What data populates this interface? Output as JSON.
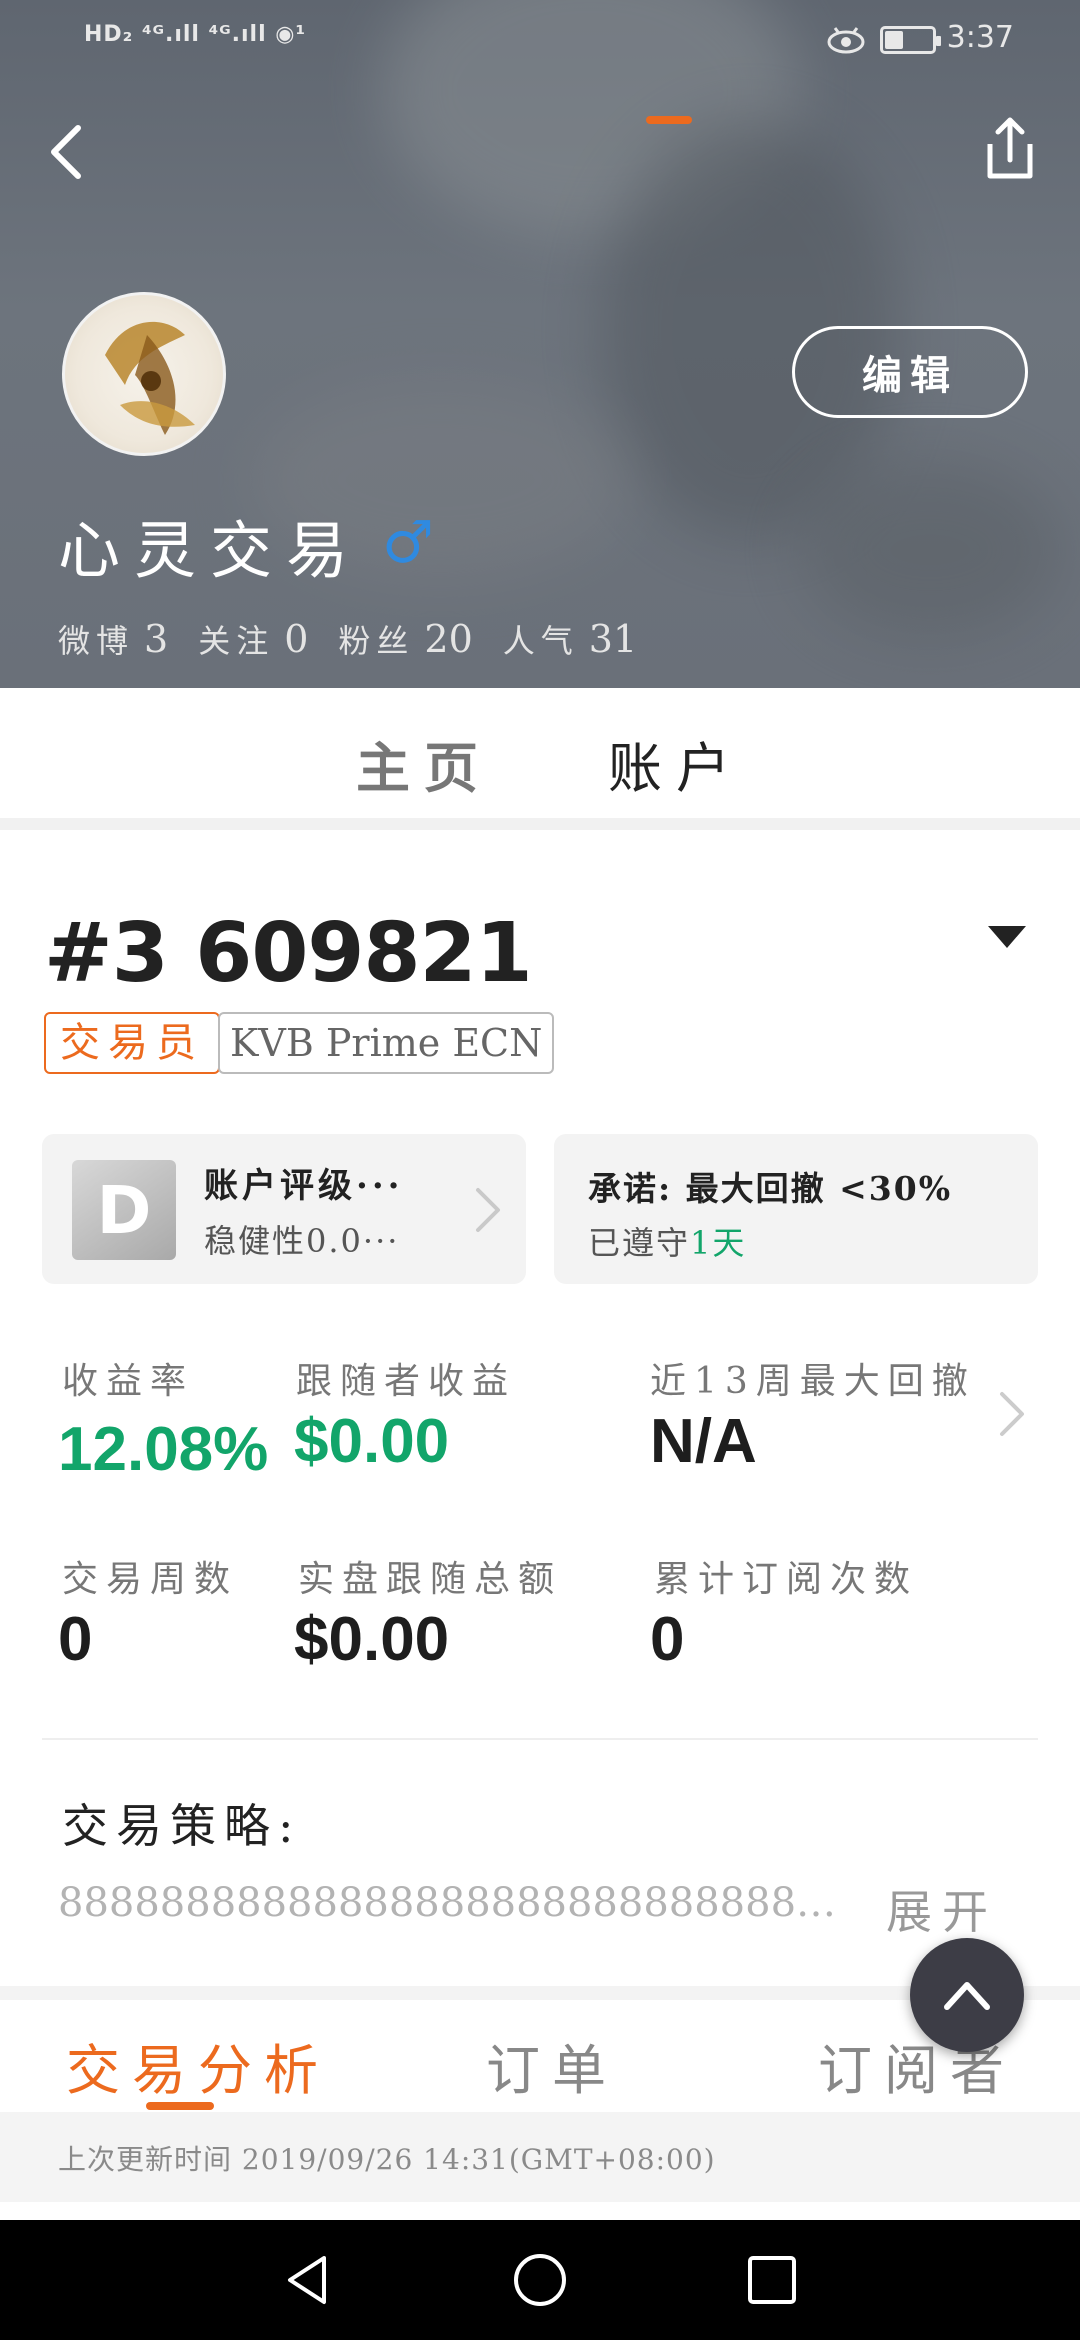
{
  "status_bar": {
    "left_icons": "HD₂ ⁴ᴳ.ıll ⁴ᴳ.ıll ◉¹",
    "time": "3:37",
    "battery_level": 0.4
  },
  "profile": {
    "username": "心灵交易",
    "gender_symbol": "♂",
    "edit_label": "编辑",
    "stats": [
      {
        "label": "微博",
        "value": "3"
      },
      {
        "label": "关注",
        "value": "0"
      },
      {
        "label": "粉丝",
        "value": "20"
      },
      {
        "label": "人气",
        "value": "31"
      }
    ]
  },
  "tabs": {
    "home": "主页",
    "account": "账户"
  },
  "account": {
    "number": "#3 609821",
    "tag_role": "交易员",
    "tag_server": "KVB Prime ECN",
    "rating": {
      "grade": "D",
      "title": "账户评级···",
      "subtitle": "稳健性0.0···"
    },
    "promise": {
      "title": "承诺: 最大回撤 <30%",
      "kept_prefix": "已遵守",
      "kept_days": "1天"
    }
  },
  "metrics": [
    {
      "label": "收益率",
      "value": "12.08%"
    },
    {
      "label": "跟随者收益",
      "value": "$0.00"
    },
    {
      "label": "近13周最大回撤",
      "value": "N/A"
    },
    {
      "label": "交易周数",
      "value": "0"
    },
    {
      "label": "实盘跟随总额",
      "value": "$0.00"
    },
    {
      "label": "累计订阅次数",
      "value": "0"
    }
  ],
  "strategy": {
    "label": "交易策略:",
    "text": "8888888888888888888888888888888888888888",
    "expand": "展开"
  },
  "sub_tabs": {
    "analysis": "交易分析",
    "orders": "订单",
    "subscribers": "订阅者"
  },
  "update_time": "上次更新时间 2019/09/26 14:31(GMT+08:00)",
  "colors": {
    "accent": "#ec6a1e",
    "positive": "#12a56a",
    "male": "#2f8ae0"
  },
  "icons": [
    "back-icon",
    "share-icon",
    "eye-icon",
    "battery-icon",
    "dropdown-icon",
    "chevron-right-icon",
    "arrow-up-icon",
    "nav-back-icon",
    "nav-home-icon",
    "nav-recent-icon"
  ]
}
